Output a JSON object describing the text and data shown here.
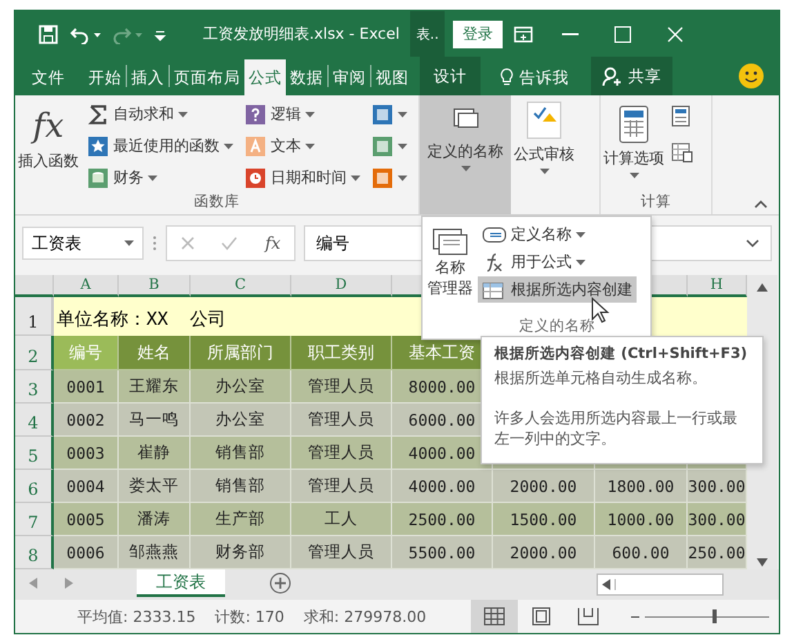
{
  "window": {
    "title": "工资发放明细表.xlsx - Excel",
    "context_tab": "表..",
    "login": "登录"
  },
  "ribbon_tabs": [
    {
      "label": "文件",
      "kind": "file",
      "selected": false
    },
    {
      "label": "开始",
      "kind": "normal",
      "selected": false
    },
    {
      "label": "插入",
      "kind": "normal",
      "selected": false
    },
    {
      "label": "页面布局",
      "kind": "normal",
      "selected": false
    },
    {
      "label": "公式",
      "kind": "normal",
      "selected": true
    },
    {
      "label": "数据",
      "kind": "normal",
      "selected": false
    },
    {
      "label": "审阅",
      "kind": "normal",
      "selected": false
    },
    {
      "label": "视图",
      "kind": "normal",
      "selected": false
    },
    {
      "label": "设计",
      "kind": "context",
      "selected": false
    }
  ],
  "tell_me": "告诉我",
  "share": "共享",
  "ribbon": {
    "insert_function_symbol": "fx",
    "insert_function": "插入函数",
    "function_library": [
      {
        "label": "自动求和",
        "kind": "sum"
      },
      {
        "label": "最近使用的函数",
        "kind": "recent"
      },
      {
        "label": "财务",
        "kind": "finance"
      },
      {
        "label": "逻辑",
        "kind": "logic"
      },
      {
        "label": "文本",
        "kind": "text"
      },
      {
        "label": "日期和时间",
        "kind": "date"
      }
    ],
    "function_library_label": "函数库",
    "defined_names": {
      "label": "定义的名称",
      "pressed": true
    },
    "formula_auditing": "公式审核",
    "calc_options": "计算选项",
    "calculation_label": "计算"
  },
  "formula_bar": {
    "name_box": "工资表",
    "fx_symbol": "fx",
    "content": "编号"
  },
  "column_headers_left": [
    "A",
    "B",
    "C",
    "D"
  ],
  "column_header_right": "H",
  "rows": [
    {
      "number": "1",
      "kind": "title",
      "selected": false,
      "text": "单位名称：XX  公司"
    },
    {
      "number": "2",
      "kind": "header",
      "selected": true,
      "cells": [
        {
          "text": "编号",
          "selected": true
        },
        {
          "text": "姓名",
          "selected": false
        },
        {
          "text": "所属部门",
          "selected": false
        },
        {
          "text": "职工类别",
          "selected": false
        },
        {
          "text": "基本工资",
          "selected": false
        }
      ]
    },
    {
      "number": "3",
      "kind": "data",
      "selected": true,
      "cells": [
        "0001",
        "王耀东",
        "办公室",
        "管理人员",
        "8000.00"
      ]
    },
    {
      "number": "4",
      "kind": "data",
      "selected": true,
      "cells": [
        "0002",
        "马一鸣",
        "办公室",
        "管理人员",
        "6000.00"
      ]
    },
    {
      "number": "5",
      "kind": "data",
      "selected": true,
      "cells": [
        "0003",
        "崔静",
        "销售部",
        "管理人员",
        "4000.00"
      ]
    },
    {
      "number": "6",
      "kind": "data",
      "selected": true,
      "cells": [
        "0004",
        "娄太平",
        "销售部",
        "管理人员",
        "4000.00",
        "2000.00",
        "1800.00",
        "300.00"
      ]
    },
    {
      "number": "7",
      "kind": "data",
      "selected": true,
      "cells": [
        "0005",
        "潘涛",
        "生产部",
        "工人",
        "2500.00",
        "1500.00",
        "1000.00",
        "300.00"
      ]
    },
    {
      "number": "8",
      "kind": "data",
      "selected": true,
      "cells": [
        "0006",
        "邹燕燕",
        "财务部",
        "管理人员",
        "5500.00",
        "2000.00",
        "600.00",
        "250.00"
      ]
    }
  ],
  "names_menu": {
    "manager_lines": [
      "名称",
      "管理器"
    ],
    "items": [
      {
        "label": "定义名称",
        "kind": "define",
        "dropdown": true,
        "selected": false
      },
      {
        "label": "用于公式",
        "kind": "formula",
        "dropdown": true,
        "selected": false
      },
      {
        "label": "根据所选内容创建",
        "kind": "create",
        "dropdown": false,
        "selected": true
      }
    ],
    "footer": "定义的名称"
  },
  "tooltip": {
    "title": "根据所选内容创建 (Ctrl+Shift+F3)",
    "lines": [
      "根据所选单元格自动生成名称。",
      "许多人会选用所选内容最上一行或最左一列中的文字。"
    ]
  },
  "sheet_tabs": [
    {
      "label": "工资表",
      "selected": true
    }
  ],
  "status_bar": {
    "stats": [
      "平均值: 2333.15",
      "计数: 170",
      "求和: 279978.00"
    ],
    "views": [
      {
        "kind": "normal",
        "selected": true
      },
      {
        "kind": "page_layout",
        "selected": false
      },
      {
        "kind": "page_break",
        "selected": false
      }
    ],
    "zoom": {
      "level": 0.55
    }
  }
}
